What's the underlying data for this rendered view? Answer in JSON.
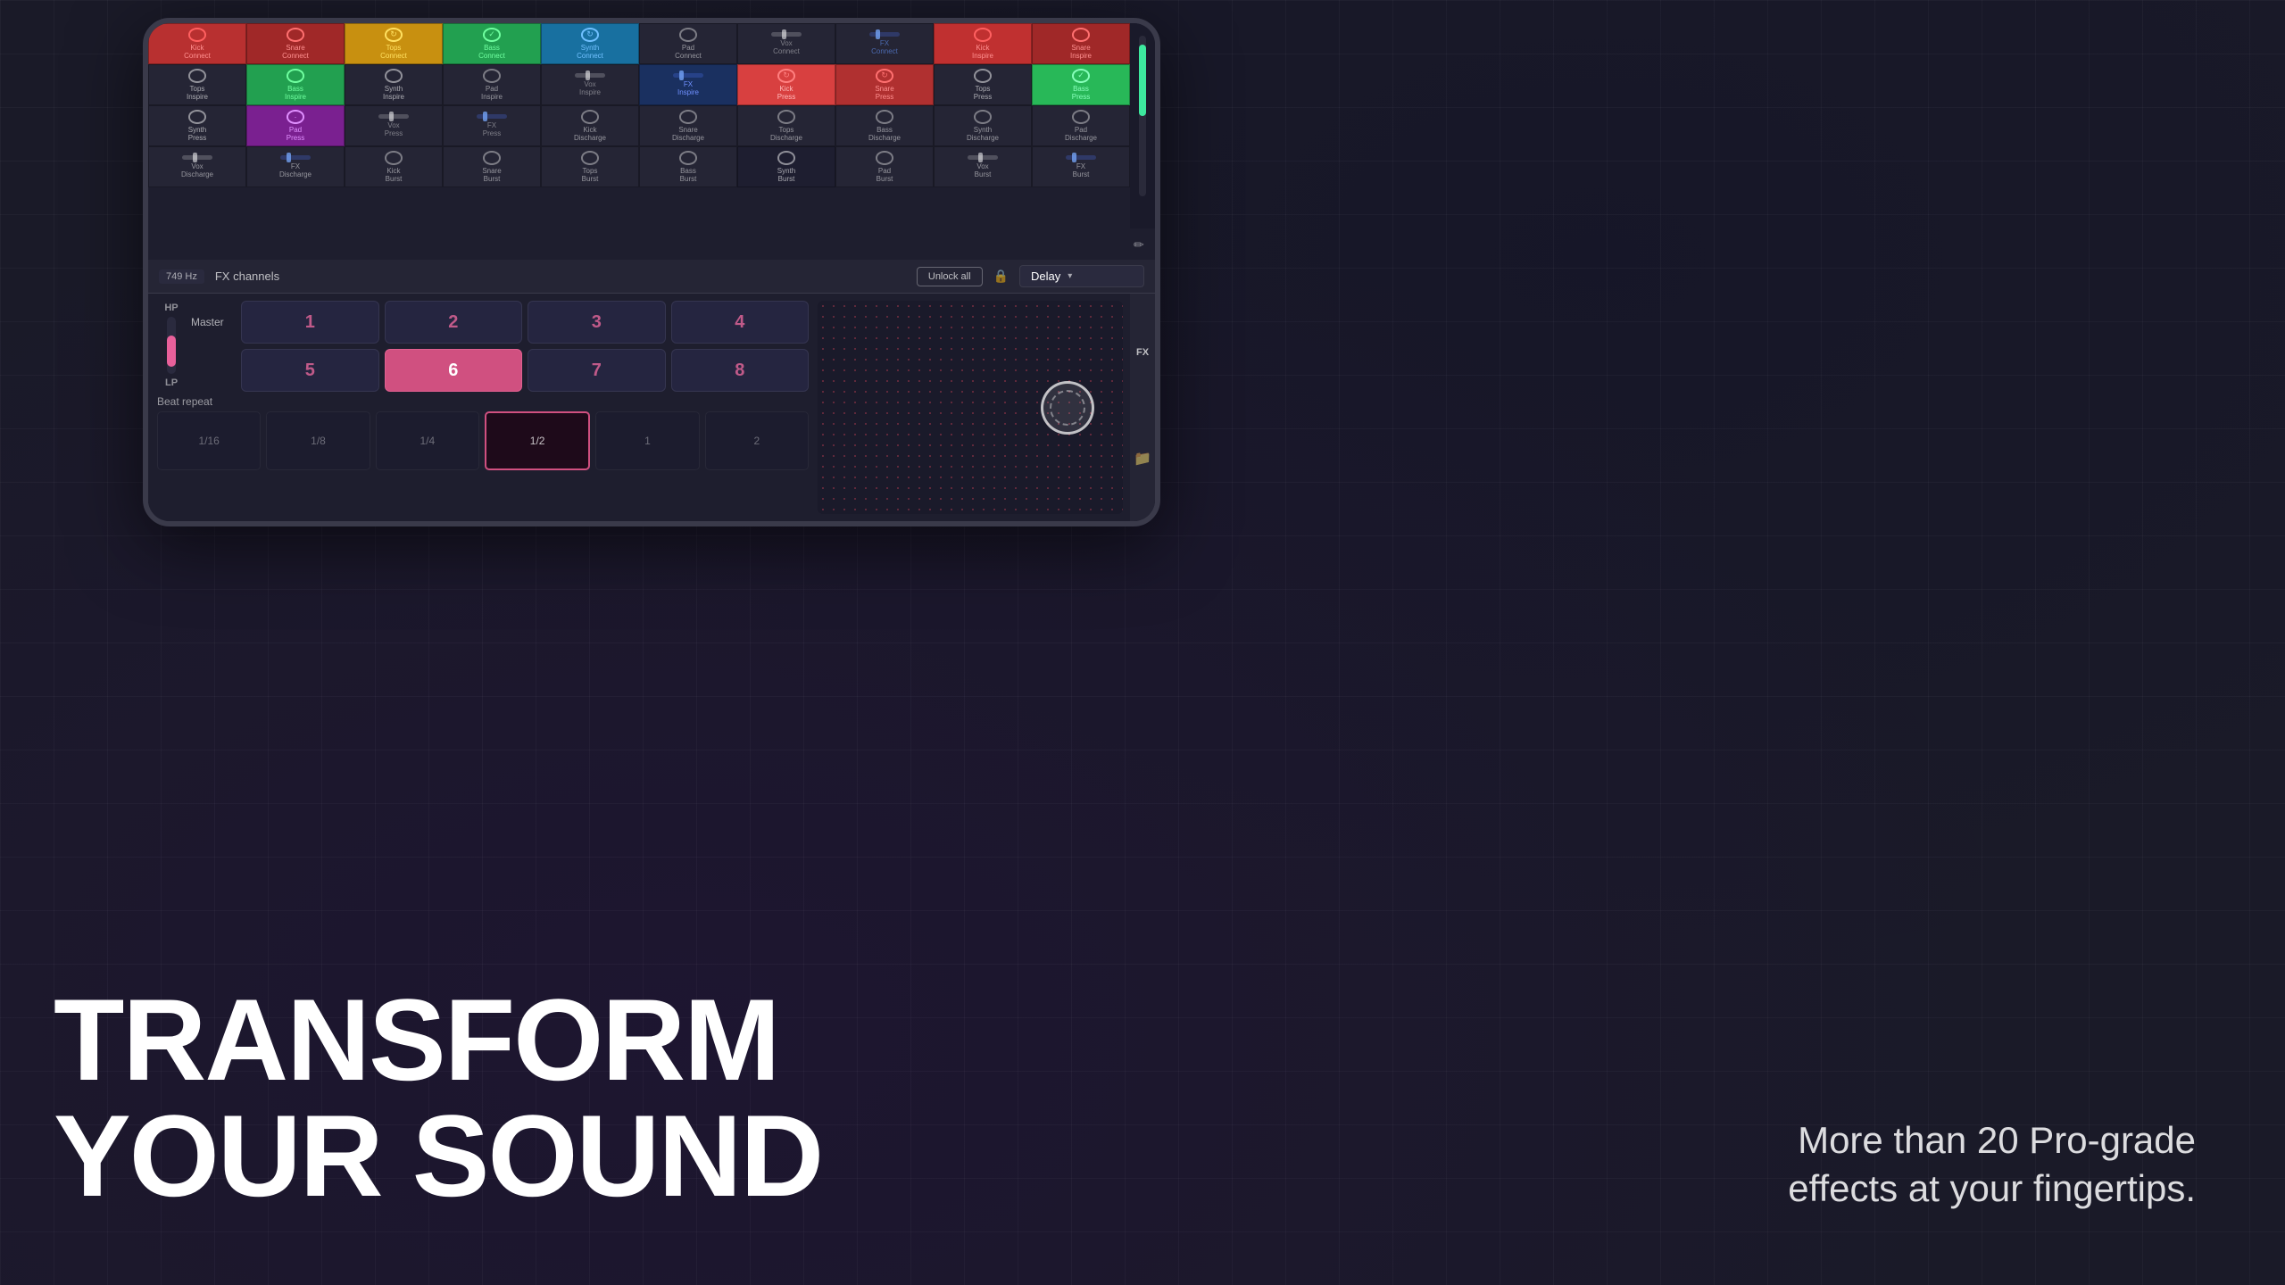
{
  "background": {
    "color": "#1a1a28"
  },
  "tablet": {
    "pad_grid": {
      "rows": [
        {
          "name": "connect",
          "cells": [
            {
              "label": "Kick\nConnect",
              "style": "kick-connect",
              "icon": "circle"
            },
            {
              "label": "Snare\nConnect",
              "style": "snare-connect",
              "icon": "circle"
            },
            {
              "label": "Tops\nConnect",
              "style": "tops-connect",
              "icon": "circle-arrow"
            },
            {
              "label": "Bass\nConnect",
              "style": "bass-connect",
              "icon": "circle-check"
            },
            {
              "label": "Synth\nConnect",
              "style": "synth-connect",
              "icon": "circle-arrow"
            },
            {
              "label": "Pad\nConnect",
              "style": "pad-connect",
              "icon": "circle"
            },
            {
              "label": "Vox\nConnect",
              "style": "vox-connect",
              "icon": "slider"
            },
            {
              "label": "FX\nConnect",
              "style": "fx-connect",
              "icon": "slider-blue"
            }
          ]
        },
        {
          "name": "inspire",
          "cells": [
            {
              "label": "Kick\nInspire",
              "style": "kick-inspire",
              "icon": "circle"
            },
            {
              "label": "Snare\nInspire",
              "style": "snare-inspire",
              "icon": "circle"
            },
            {
              "label": "Tops\nInspire",
              "style": "tops-inspire",
              "icon": "circle"
            },
            {
              "label": "Bass\nInspire",
              "style": "bass-inspire",
              "icon": "circle"
            },
            {
              "label": "Synth\nInspire",
              "style": "synth-inspire",
              "icon": "circle"
            },
            {
              "label": "Pad\nInspire",
              "style": "pad-inspire",
              "icon": "circle"
            },
            {
              "label": "Vox\nInspire",
              "style": "vox-inspire",
              "icon": "slider"
            },
            {
              "label": "FX\nInspire",
              "style": "fx-inspire",
              "icon": "slider-blue"
            }
          ]
        },
        {
          "name": "press",
          "cells": [
            {
              "label": "Kick\nPress",
              "style": "kick-press",
              "icon": "circle-rotate"
            },
            {
              "label": "Snare\nPress",
              "style": "snare-press",
              "icon": "circle-rotate"
            },
            {
              "label": "Tops\nPress",
              "style": "tops-press",
              "icon": "circle"
            },
            {
              "label": "Bass\nPress",
              "style": "bass-press",
              "icon": "circle-check"
            },
            {
              "label": "Synth\nPress",
              "style": "synth-press",
              "icon": "circle"
            },
            {
              "label": "Pad\nPress",
              "style": "pad-press",
              "icon": "circle-dot"
            },
            {
              "label": "Vox\nPress",
              "style": "vox-press",
              "icon": "slider"
            },
            {
              "label": "FX\nPress",
              "style": "fx-press",
              "icon": "slider-blue"
            }
          ]
        },
        {
          "name": "discharge",
          "cells": [
            {
              "label": "Kick\nDischarge",
              "style": "discharge",
              "icon": "circle"
            },
            {
              "label": "Snare\nDischarge",
              "style": "discharge",
              "icon": "circle"
            },
            {
              "label": "Tops\nDischarge",
              "style": "discharge",
              "icon": "circle"
            },
            {
              "label": "Bass\nDischarge",
              "style": "discharge",
              "icon": "circle"
            },
            {
              "label": "Synth\nDischarge",
              "style": "discharge",
              "icon": "circle"
            },
            {
              "label": "Pad\nDischarge",
              "style": "discharge",
              "icon": "circle"
            },
            {
              "label": "Vox\nDischarge",
              "style": "discharge",
              "icon": "slider"
            },
            {
              "label": "FX\nDischarge",
              "style": "discharge",
              "icon": "slider-blue"
            }
          ]
        },
        {
          "name": "burst",
          "cells": [
            {
              "label": "Kick\nBurst",
              "style": "burst",
              "icon": "circle"
            },
            {
              "label": "Snare\nBurst",
              "style": "burst",
              "icon": "circle"
            },
            {
              "label": "Tops\nBurst",
              "style": "burst",
              "icon": "circle"
            },
            {
              "label": "Bass\nBurst",
              "style": "burst",
              "icon": "circle"
            },
            {
              "label": "Synth\nBurst",
              "style": "synth-burst",
              "icon": "circle"
            },
            {
              "label": "Pad\nBurst",
              "style": "burst",
              "icon": "circle"
            },
            {
              "label": "Vox\nBurst",
              "style": "burst",
              "icon": "slider"
            },
            {
              "label": "FX\nBurst",
              "style": "burst",
              "icon": "slider-blue"
            }
          ]
        }
      ]
    },
    "fx_panel": {
      "frequency": "749 Hz",
      "channels_label": "FX channels",
      "unlock_button": "Unlock all",
      "effect_name": "Delay",
      "channel_numbers": [
        "1",
        "2",
        "3",
        "4",
        "5",
        "6",
        "7",
        "8"
      ],
      "active_channel": "6",
      "master_label": "Master",
      "beat_repeat_label": "Beat repeat",
      "beat_values": [
        "1/16",
        "1/8",
        "1/4",
        "1/2",
        "1",
        "2"
      ],
      "active_beat": "1/2",
      "fx_label": "FX",
      "hp_label": "HP",
      "lp_label": "LP"
    }
  },
  "marketing": {
    "headline_line1": "TRANSFORM",
    "headline_line2": "YOUR SOUND",
    "description": "More than 20 Pro-grade\neffects at your fingertips."
  }
}
